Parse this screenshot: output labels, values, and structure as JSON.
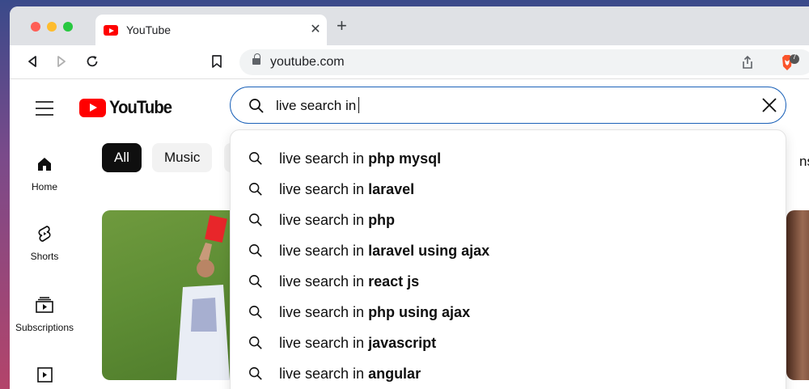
{
  "browser": {
    "tab_title": "YouTube",
    "url": "youtube.com",
    "extension_badge": "7"
  },
  "youtube": {
    "logo_text": "YouTube",
    "search_query": "live search in",
    "sidebar": [
      {
        "label": "Home",
        "icon": "home-icon"
      },
      {
        "label": "Shorts",
        "icon": "shorts-icon"
      },
      {
        "label": "Subscriptions",
        "icon": "subscriptions-icon"
      },
      {
        "label": "",
        "icon": "library-icon"
      }
    ],
    "chips": [
      "All",
      "Music"
    ],
    "chip_peek": "ns",
    "suggestions": [
      {
        "prefix": "live search in ",
        "completion": "php mysql"
      },
      {
        "prefix": "live search in ",
        "completion": "laravel"
      },
      {
        "prefix": "live search in ",
        "completion": "php"
      },
      {
        "prefix": "live search in ",
        "completion": "laravel using ajax"
      },
      {
        "prefix": "live search in ",
        "completion": "react js"
      },
      {
        "prefix": "live search in ",
        "completion": "php using ajax"
      },
      {
        "prefix": "live search in ",
        "completion": "javascript"
      },
      {
        "prefix": "live search in ",
        "completion": "angular"
      }
    ]
  },
  "colors": {
    "accent": "#1c62b9",
    "brand_red": "#ff0000"
  }
}
